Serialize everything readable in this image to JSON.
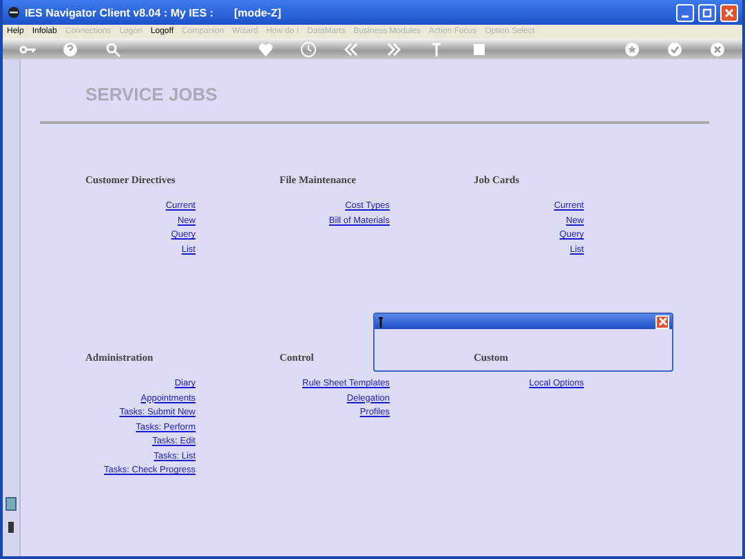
{
  "window": {
    "title": "IES Navigator Client v8.04 : My IES :",
    "mode": "[mode-Z]"
  },
  "menu": [
    {
      "label": "Help",
      "disabled": false
    },
    {
      "label": "Infolab",
      "disabled": false
    },
    {
      "label": "Connections",
      "disabled": true
    },
    {
      "label": "Logon",
      "disabled": true
    },
    {
      "label": "Logoff",
      "disabled": false
    },
    {
      "label": "Companion",
      "disabled": true
    },
    {
      "label": "Wizard",
      "disabled": true
    },
    {
      "label": "How do I",
      "disabled": true
    },
    {
      "label": "DataMarts",
      "disabled": true
    },
    {
      "label": "Business Modules",
      "disabled": true
    },
    {
      "label": "Action Focus",
      "disabled": true
    },
    {
      "label": "Option Select",
      "disabled": true
    }
  ],
  "page": {
    "title": "SERVICE JOBS"
  },
  "sections": [
    [
      {
        "heading": "Customer Directives",
        "links": [
          "Current",
          "New",
          "Query",
          "List"
        ]
      },
      {
        "heading": "File Maintenance",
        "links": [
          "Cost Types",
          "Bill of Materials"
        ]
      },
      {
        "heading": "Job Cards",
        "links": [
          "Current",
          "New",
          "Query",
          "List"
        ]
      }
    ],
    [
      {
        "heading": "Administration",
        "links": [
          "Diary",
          "Appointments",
          "Tasks: Submit New",
          "Tasks: Perform",
          "Tasks: Edit",
          "Tasks: List",
          "Tasks: Check Progress"
        ]
      },
      {
        "heading": "Control",
        "links": [
          "Rule Sheet Templates",
          "Delegation",
          "Profiles"
        ]
      },
      {
        "heading": "Custom",
        "links": [
          "Local Options"
        ]
      }
    ]
  ]
}
